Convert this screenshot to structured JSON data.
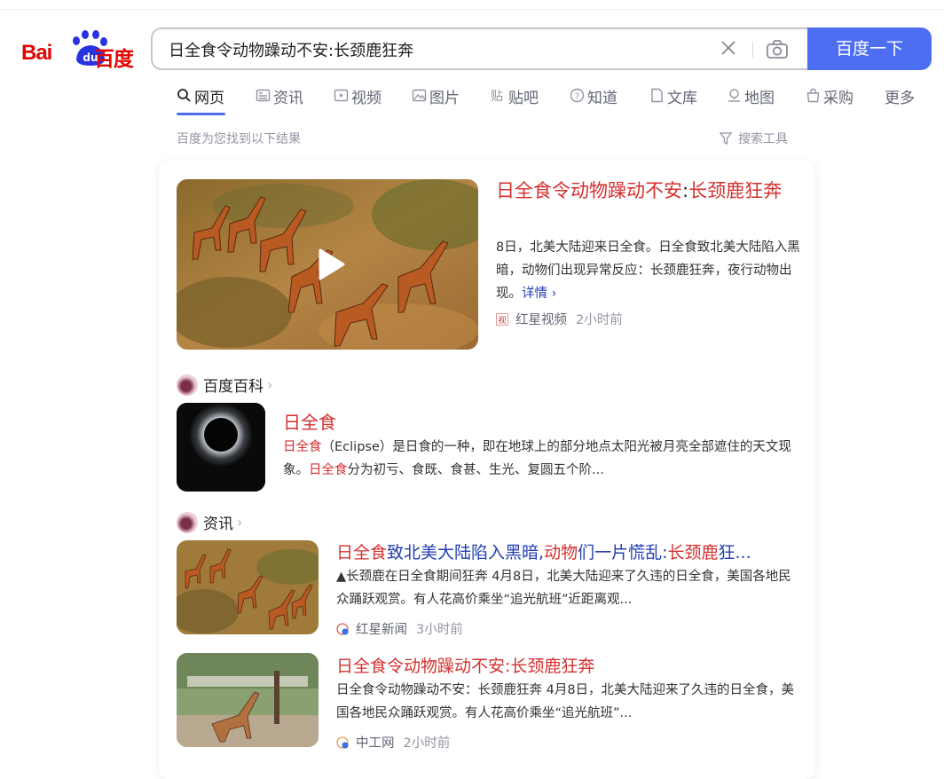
{
  "logo": {
    "text_left": "Bai",
    "paw_text": "du",
    "text_right": "百度"
  },
  "search": {
    "value": "日全食令动物躁动不安:长颈鹿狂奔",
    "button": "百度一下"
  },
  "tabs": [
    {
      "label": "网页",
      "icon": "search-icon"
    },
    {
      "label": "资讯",
      "icon": "news-icon"
    },
    {
      "label": "视频",
      "icon": "video-icon"
    },
    {
      "label": "图片",
      "icon": "image-icon"
    },
    {
      "label": "贴吧",
      "icon": "tieba-icon"
    },
    {
      "label": "知道",
      "icon": "question-icon"
    },
    {
      "label": "文库",
      "icon": "document-icon"
    },
    {
      "label": "地图",
      "icon": "map-pin-icon"
    },
    {
      "label": "采购",
      "icon": "shopping-icon"
    },
    {
      "label": "更多",
      "icon": ""
    }
  ],
  "result_count": "百度为您找到以下结果",
  "search_tools": "搜索工具",
  "main_result": {
    "title_part1": "日全食令动物躁动不安",
    "title_sep": ":",
    "title_part2": "长颈鹿狂奔",
    "summary": "8日，北美大陆迎来日全食。日全食致北美大陆陷入黑暗，动物们出现异常反应：长颈鹿狂奔，夜行动物出现。",
    "more": "详情",
    "source": "红星视频",
    "time": "2小时前"
  },
  "baike": {
    "section": "百度百科",
    "title": "日全食",
    "hl1": "日全食",
    "text1": "（Eclipse）是日食的一种，即在地球上的部分地点太阳光被月亮全部遮住的天文现象。",
    "hl2": "日全食",
    "text2": "分为初亏、食既、食甚、生光、复圆五个阶..."
  },
  "news": {
    "section": "资讯",
    "items": [
      {
        "t1": "日全食",
        "t2": "致北美大陆陷入黑暗,",
        "t3": "动物",
        "t4": "们一片慌乱:",
        "t5": "长颈鹿",
        "t6": "狂...",
        "summary": "▲长颈鹿在日全食期间狂奔 4月8日，北美大陆迎来了久违的日全食，美国各地民众踊跃观赏。有人花高价乘坐“追光航班”近距离观...",
        "source": "红星新闻",
        "time": "3小时前"
      },
      {
        "title": "日全食令动物躁动不安:长颈鹿狂奔",
        "summary": "日全食令动物躁动不安：长颈鹿狂奔 4月8日，北美大陆迎来了久违的日全食，美国各地民众踊跃观赏。有人花高价乘坐“追光航班”...",
        "source": "中工网",
        "time": "2小时前"
      }
    ]
  }
}
